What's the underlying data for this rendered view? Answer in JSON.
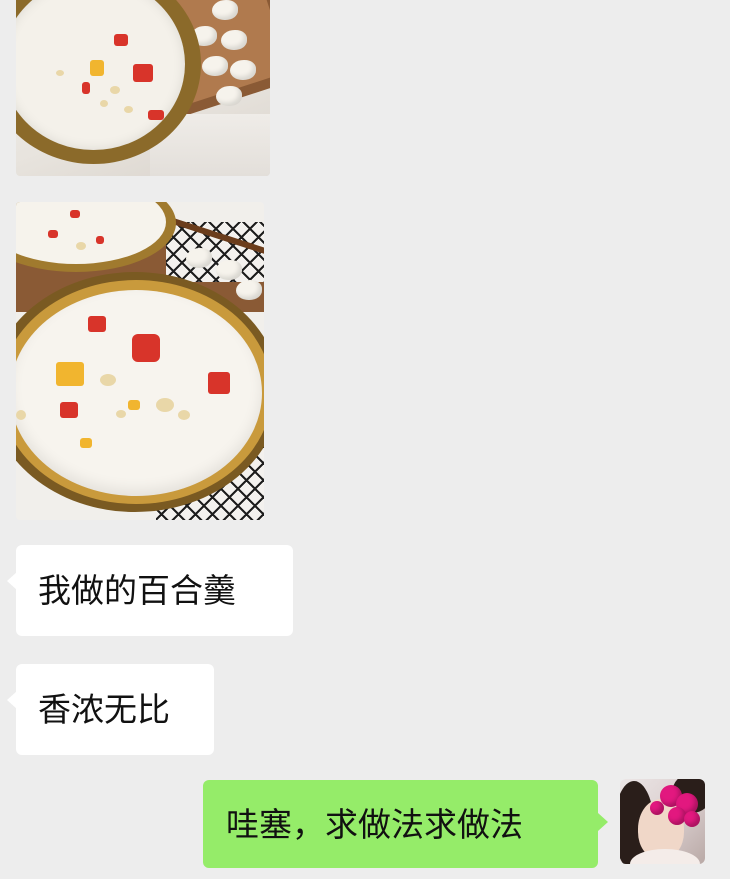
{
  "messages": [
    {
      "type": "image",
      "side": "left",
      "description": "food-photo-bowl-and-lily-bulbs"
    },
    {
      "type": "image",
      "side": "left",
      "description": "food-photo-lily-soup-bowls"
    },
    {
      "type": "text",
      "side": "left",
      "text": "我做的百合羹"
    },
    {
      "type": "text",
      "side": "left",
      "text": "香浓无比"
    },
    {
      "type": "text",
      "side": "right",
      "text": "哇塞，求做法求做法"
    }
  ],
  "colors": {
    "background": "#ededed",
    "incoming_bubble": "#ffffff",
    "outgoing_bubble": "#95ec69"
  },
  "icons": {
    "self_avatar": "user-avatar-photo"
  }
}
